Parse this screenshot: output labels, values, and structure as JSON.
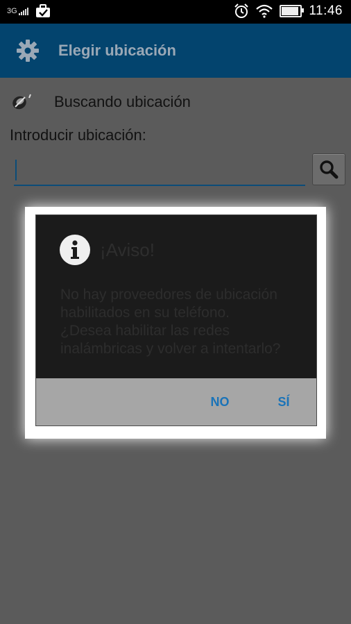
{
  "status_bar": {
    "network": "3G",
    "time": "11:46",
    "icons": [
      "signal-icon",
      "briefcase-check-icon",
      "alarm-icon",
      "wifi-icon",
      "battery-icon"
    ],
    "battery_level": 0.85
  },
  "app_bar": {
    "title": "Elegir ubicación",
    "icon": "gear-icon",
    "background": "#03446e"
  },
  "location": {
    "status_text": "Buscando ubicación",
    "status_icon": "satellite-icon",
    "input_label": "Introducir ubicación:",
    "input_value": "",
    "search_icon": "search-icon"
  },
  "dialog": {
    "icon": "info-icon",
    "title": "¡Aviso!",
    "message": "No hay proveedores de ubicación habilitados en su teléfono. ¿Desea habilitar las redes inalámbricas y volver a intentarlo?",
    "buttons": {
      "no": "NO",
      "yes": "SÍ"
    },
    "accent": "#1a73b8"
  }
}
